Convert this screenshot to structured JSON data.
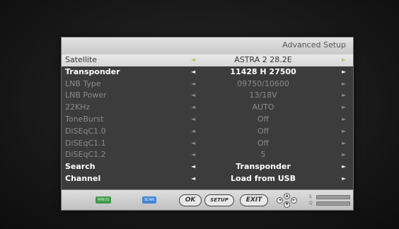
{
  "header": {
    "title": "Advanced Setup"
  },
  "rows": [
    {
      "label": "Satellite",
      "value": "ASTRA 2 28.2E",
      "state": "selected",
      "left_arrow": "◄",
      "right_arrow": "►"
    },
    {
      "label": "Transponder",
      "value": "11428 H 27500",
      "state": "active",
      "left_arrow": "◄",
      "right_arrow": "►"
    },
    {
      "label": "LNB Type",
      "value": "09750/10600",
      "state": "dim",
      "left_arrow": "◄",
      "right_arrow": "►"
    },
    {
      "label": "LNB Power",
      "value": "13/18V",
      "state": "dim",
      "left_arrow": "◄",
      "right_arrow": "►"
    },
    {
      "label": "22KHz",
      "value": "AUTO",
      "state": "dim",
      "left_arrow": "◄",
      "right_arrow": "►"
    },
    {
      "label": "ToneBurst",
      "value": "Off",
      "state": "dim",
      "left_arrow": "◄",
      "right_arrow": "►"
    },
    {
      "label": "DiSEqC1.0",
      "value": "Off",
      "state": "dim",
      "left_arrow": "◄",
      "right_arrow": "►"
    },
    {
      "label": "DiSEqC1.1",
      "value": "Off",
      "state": "dim",
      "left_arrow": "◄",
      "right_arrow": "►"
    },
    {
      "label": "DiSEqC1.2",
      "value": "5",
      "state": "dim",
      "left_arrow": "◄",
      "right_arrow": "►"
    },
    {
      "label": "Search",
      "value": "Transponder",
      "state": "active",
      "left_arrow": "◄",
      "right_arrow": "►"
    },
    {
      "label": "Channel",
      "value": "Load from USB",
      "state": "active",
      "left_arrow": "◄",
      "right_arrow": "►"
    }
  ],
  "footer": {
    "green_key": "MINUS",
    "blue_key": "SCAN",
    "ok": "OK",
    "setup": "SETUP",
    "exit": "EXIT",
    "signal_labels": {
      "s": "S",
      "q": "Q"
    },
    "signal_strength": 0.0,
    "signal_quality": 0.0
  },
  "colors": {
    "accent_arrow": "#9ccc5a",
    "header_bg": "#d0d0d0",
    "panel_bg": "#3c3c3c"
  },
  "icons": {
    "left_arrow": "left-triangle-icon",
    "right_arrow": "right-triangle-icon",
    "nav_pad": "directional-pad-icon"
  }
}
